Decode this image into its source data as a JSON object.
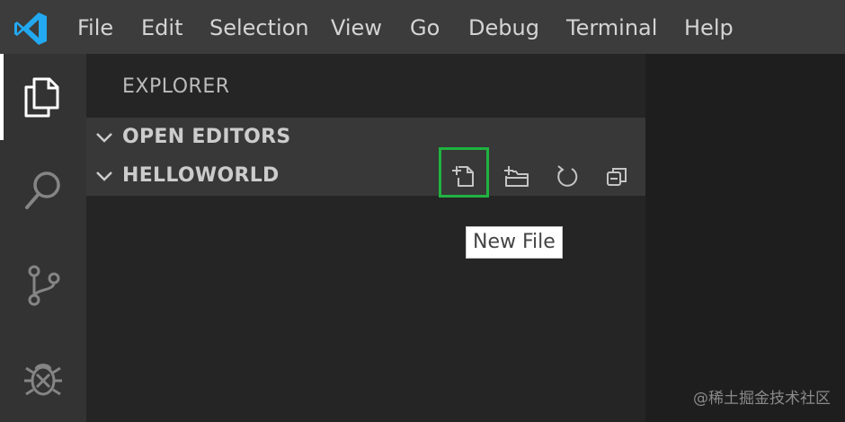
{
  "menubar": {
    "items": [
      "File",
      "Edit",
      "Selection",
      "View",
      "Go",
      "Debug",
      "Terminal",
      "Help"
    ]
  },
  "activitybar": {
    "items": [
      {
        "icon": "explorer-icon",
        "active": true
      },
      {
        "icon": "search-icon",
        "active": false
      },
      {
        "icon": "source-control-icon",
        "active": false
      },
      {
        "icon": "debug-icon",
        "active": false
      }
    ]
  },
  "sidebar": {
    "title": "EXPLORER",
    "sections": [
      {
        "label": "OPEN EDITORS",
        "expanded": true
      },
      {
        "label": "HELLOWORLD",
        "expanded": true
      }
    ],
    "toolbar": [
      "new-file-icon",
      "new-folder-icon",
      "refresh-icon",
      "collapse-all-icon"
    ]
  },
  "tooltip": {
    "text": "New File"
  },
  "watermark": {
    "text": "@稀土掘金技术社区"
  },
  "colors": {
    "menubar": "#3c3c3c",
    "activitybar": "#333333",
    "sidebar": "#252526",
    "section": "#383838",
    "highlight": "#1fb340",
    "logo": "#23a9f2"
  }
}
